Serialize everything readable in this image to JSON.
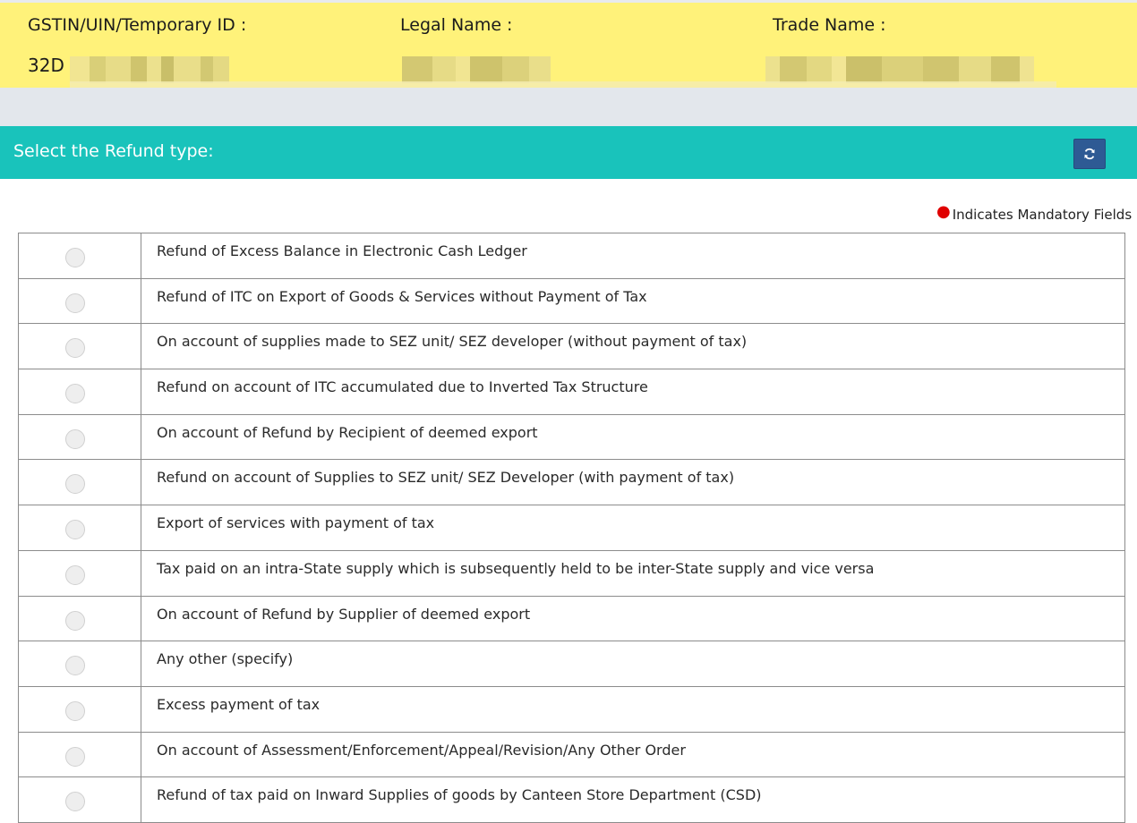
{
  "header": {
    "gstin_label": "GSTIN/UIN/Temporary ID :",
    "gstin_value": "32D",
    "legal_name_label": "Legal Name :",
    "trade_name_label": "Trade Name :"
  },
  "section": {
    "title": "Select the Refund type:",
    "refresh_icon": "refresh-icon"
  },
  "mandatory_note": "Indicates Mandatory Fields",
  "refund_types": [
    "Refund of Excess Balance in Electronic Cash Ledger",
    "Refund of ITC on Export of Goods & Services without Payment of Tax",
    "On account of supplies made to SEZ unit/ SEZ developer (without payment of tax)",
    "Refund on account of ITC accumulated due to Inverted Tax Structure",
    "On account of Refund by Recipient of deemed export",
    "Refund on account of Supplies to SEZ unit/ SEZ Developer (with payment of tax)",
    "Export of services with payment of tax",
    "Tax paid on an intra-State supply which is subsequently held to be inter-State supply and vice versa",
    "On account of Refund by Supplier of deemed export",
    "Any other (specify)",
    "Excess payment of tax",
    "On account of Assessment/Enforcement/Appeal/Revision/Any Other Order",
    "Refund of tax paid on Inward Supplies of goods by Canteen Store Department (CSD)"
  ],
  "colors": {
    "header_bg": "#fff27a",
    "section_bg": "#19c3bb",
    "button_bg": "#2e5a94",
    "mandatory_dot": "#e00000"
  }
}
